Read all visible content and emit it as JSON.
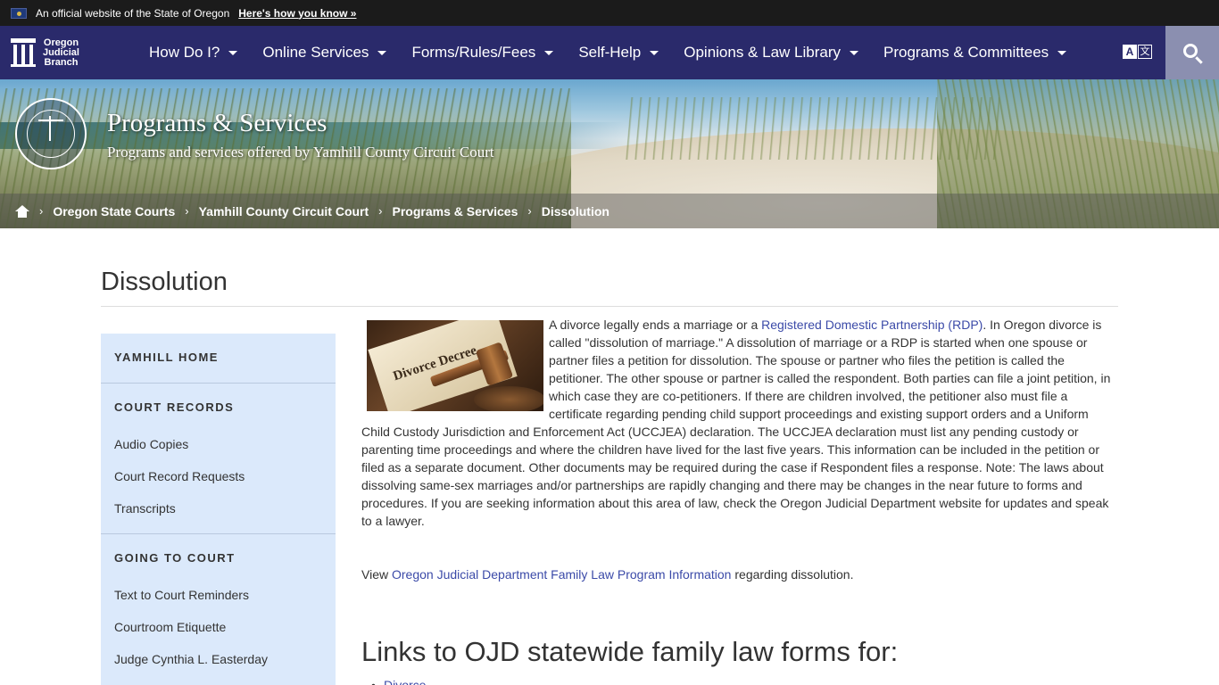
{
  "banner": {
    "official_text": "An official website of the State of Oregon",
    "how_link": "Here's how you know »"
  },
  "logo": {
    "line1": "Oregon",
    "line2": "Judicial",
    "line3": "Branch"
  },
  "nav": {
    "items": [
      {
        "label": "How Do I?"
      },
      {
        "label": "Online Services"
      },
      {
        "label": "Forms/Rules/Fees"
      },
      {
        "label": "Self-Help"
      },
      {
        "label": "Opinions & Law Library"
      },
      {
        "label": "Programs & Committees"
      }
    ],
    "translate_a": "A",
    "translate_b": "文",
    "icons": {
      "translate": "translate-icon",
      "search": "search-icon",
      "caret": "chevron-down-icon"
    }
  },
  "hero": {
    "title": "Programs & Services",
    "subtitle": "Programs and services offered by Yamhill County Circuit Court",
    "seal_icon": "judicial-department-seal"
  },
  "breadcrumb": {
    "items": [
      {
        "label": "Oregon State Courts"
      },
      {
        "label": "Yamhill County Circuit Court"
      },
      {
        "label": "Programs & Services"
      },
      {
        "label": "Dissolution"
      }
    ]
  },
  "page": {
    "title": "Dissolution"
  },
  "sidebar": {
    "sections": [
      {
        "heading": "YAMHILL HOME",
        "links": []
      },
      {
        "heading": "COURT RECORDS",
        "links": [
          "Audio Copies",
          "Court Record Requests",
          "Transcripts"
        ]
      },
      {
        "heading": "GOING TO COURT",
        "links": [
          "Text to Court Reminders",
          "Courtroom Etiquette",
          "Judge Cynthia L. Easterday"
        ]
      }
    ]
  },
  "article": {
    "image_caption": "Divorce Decree",
    "p1_before": "A divorce legally ends a marriage or a ",
    "p1_link": "Registered Domestic Partnership (RDP)",
    "p1_after": ". In Oregon divorce is called \"dissolution of marriage.\" A dissolution of marriage or a RDP is started when one spouse or partner files a petition for dissolution. The spouse or partner who files the petition is called the petitioner. The other spouse or partner is called the respondent. Both parties can file a joint petition, in which case they are co-petitioners. If there are children involved, the petitioner also must file a certificate regarding pending child support proceedings and existing support orders and a Uniform Child Custody Jurisdiction and Enforcement Act (UCCJEA) declaration. The UCCJEA declaration must list any pending custody or parenting time proceedings and where the children have lived for the last five years. This information can be included in the petition or filed as a separate document. Other documents may be required during the case if Respondent files a response. Note: The laws about dissolving same-sex marriages and/or partnerships are rapidly changing and there may be changes in the near future to forms and procedures. If you are seeking information about this area of law, check the Oregon Judicial Department website for updates and speak to a lawyer.",
    "p2_before": "View ",
    "p2_link": "Oregon Judicial Department Family Law Program Information",
    "p2_after": " regarding dissolution.",
    "links_heading": "Links to OJD statewide family law forms for:",
    "list": [
      "Divorce"
    ]
  },
  "colors": {
    "navbar": "#2a2a6b",
    "link": "#3b4aa8",
    "sidebar_bg": "#dbe9fb"
  }
}
